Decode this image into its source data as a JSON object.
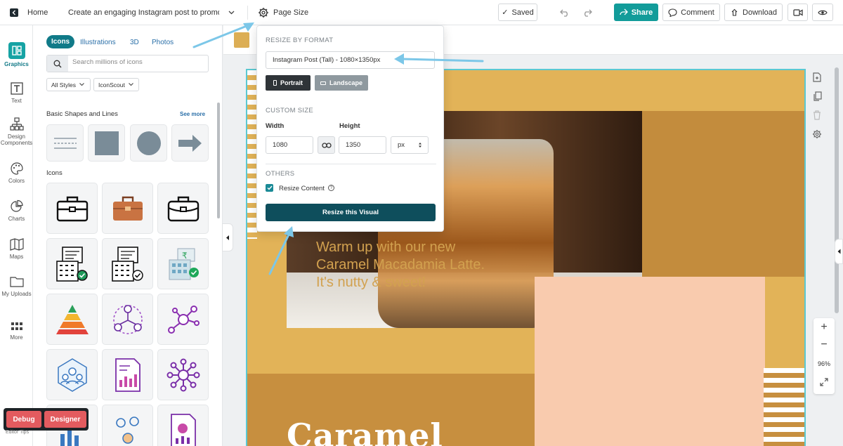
{
  "topbar": {
    "home_label": "Home",
    "doc_title": "Create an engaging Instagram post to promote a",
    "page_size_label": "Page Size",
    "saved_label": "Saved",
    "share_label": "Share",
    "comment_label": "Comment",
    "download_label": "Download"
  },
  "rail": {
    "items": [
      {
        "label": "Graphics",
        "icon": "graphics-icon"
      },
      {
        "label": "Text",
        "icon": "text-icon"
      },
      {
        "label": "Design Components",
        "icon": "components-icon"
      },
      {
        "label": "Colors",
        "icon": "palette-icon"
      },
      {
        "label": "Charts",
        "icon": "pie-chart-icon"
      },
      {
        "label": "Maps",
        "icon": "map-icon"
      },
      {
        "label": "My Uploads",
        "icon": "folder-icon"
      },
      {
        "label": "More",
        "icon": "grid-icon"
      }
    ]
  },
  "panel": {
    "tabs": [
      "Icons",
      "Illustrations",
      "3D",
      "Photos"
    ],
    "search_placeholder": "Search millions of icons",
    "filters": [
      "All Styles",
      "IconScout"
    ],
    "shapes_title": "Basic Shapes and Lines",
    "see_more": "See more",
    "icons_title": "Icons"
  },
  "popover": {
    "resize_by_format": "RESIZE BY FORMAT",
    "format_value": "Instagram Post (Tall) - 1080×1350px",
    "portrait": "Portrait",
    "landscape": "Landscape",
    "custom_size": "CUSTOM SIZE",
    "width_label": "Width",
    "height_label": "Height",
    "width_value": "1080",
    "height_value": "1350",
    "unit": "px",
    "others": "OTHERS",
    "resize_content": "Resize Content",
    "resize_button": "Resize this Visual"
  },
  "design": {
    "tagline": "Warm up with our new Caramel Macadamia Latte. It's nutty & sweet!",
    "headline": "Caramel"
  },
  "zoom": {
    "plus": "+",
    "minus": "−",
    "level": "96%"
  },
  "debug": {
    "debug_label": "Debug",
    "designer_label": "Designer",
    "tips_label": "Editor Tips"
  },
  "colors": {
    "accent": "#129c9a",
    "dark_teal": "#0e4e5c",
    "gold": "#e2b358",
    "peach": "#f9cbae",
    "debug_red": "#e35b5f"
  }
}
